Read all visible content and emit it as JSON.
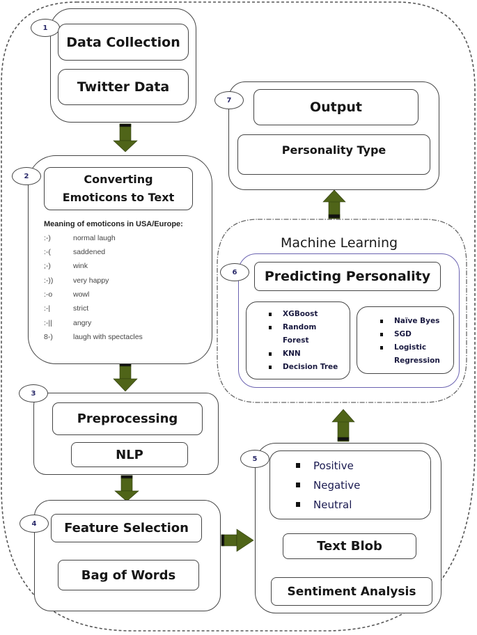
{
  "diagram": {
    "colors": {
      "arrow": "#4f6418",
      "border": "#444444",
      "ml_border": "#6a62b0"
    },
    "step1": {
      "number": "1",
      "title": "Data Collection",
      "subtitle": "Twitter Data"
    },
    "step2": {
      "number": "2",
      "title": "Converting Emoticons to Text",
      "table_title": "Meaning of emoticons in USA/Europe:",
      "emoticons": [
        {
          "symbol": ":-)",
          "meaning": "normal laugh"
        },
        {
          "symbol": ":-(",
          "meaning": "saddened"
        },
        {
          "symbol": ";-)",
          "meaning": "wink"
        },
        {
          "symbol": ":-))",
          "meaning": "very happy"
        },
        {
          "symbol": ":-o",
          "meaning": "wowl"
        },
        {
          "symbol": ":-|",
          "meaning": "strict"
        },
        {
          "symbol": ":-||",
          "meaning": "angry"
        },
        {
          "symbol": "8-)",
          "meaning": "laugh with spectacles"
        }
      ]
    },
    "step3": {
      "number": "3",
      "title": "Preprocessing",
      "subtitle": "NLP"
    },
    "step4": {
      "number": "4",
      "title": "Feature Selection",
      "subtitle": "Bag of Words"
    },
    "step5": {
      "number": "5",
      "sentiments": [
        "Positive",
        "Negative",
        "Neutral"
      ],
      "tool": "Text Blob",
      "title": "Sentiment Analysis"
    },
    "step6": {
      "group_title": "Machine Learning",
      "number": "6",
      "title": "Predicting Personality",
      "algorithms_left": [
        "XGBoost",
        "Random Forest",
        "KNN",
        "Decision Tree"
      ],
      "algorithms_right": [
        "Naïve Byes",
        "SGD",
        "Logistic Regression"
      ]
    },
    "step7": {
      "number": "7",
      "title": "Output",
      "subtitle": "Personality Type"
    }
  }
}
